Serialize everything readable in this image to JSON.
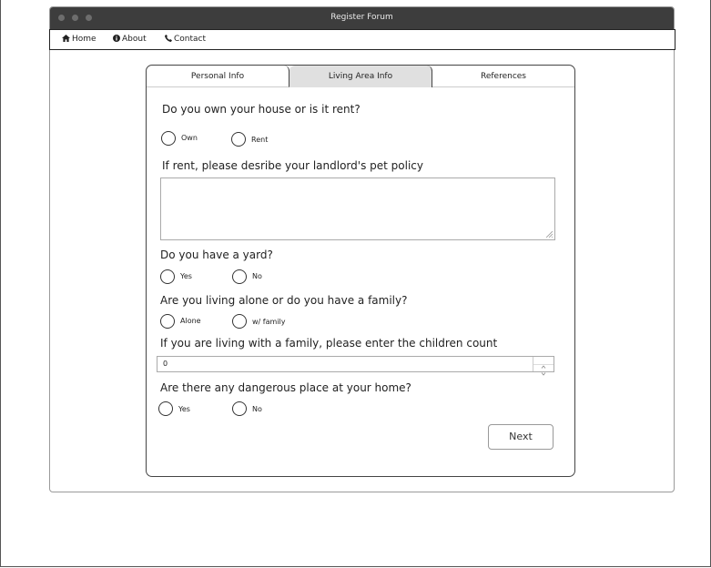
{
  "window": {
    "title": "Register Forum"
  },
  "nav": {
    "items": [
      {
        "label": "Home",
        "icon": "home-icon"
      },
      {
        "label": "About",
        "icon": "info-icon"
      },
      {
        "label": "Contact",
        "icon": "phone-icon"
      }
    ]
  },
  "tabs": [
    {
      "label": "Personal Info",
      "active": false
    },
    {
      "label": "Living Area Info",
      "active": true
    },
    {
      "label": "References",
      "active": false
    }
  ],
  "form": {
    "q_own": "Do you own your house or is it rent?",
    "own_options": [
      "Own",
      "Rent"
    ],
    "q_pet_policy": "If rent, please desribe your landlord's pet policy",
    "pet_policy_value": "",
    "q_yard": "Do you have a yard?",
    "yard_options": [
      "Yes",
      "No"
    ],
    "q_family": "Are you living alone or do you have a family?",
    "family_options": [
      "Alone",
      "w/ family"
    ],
    "q_children": "If you are living with a family, please enter the children count",
    "children_value": "0",
    "q_danger": "Are there any dangerous place at your home?",
    "danger_options": [
      "Yes",
      "No"
    ],
    "next_label": "Next"
  },
  "colors": {
    "titlebar": "#3d3d3d",
    "active_tab": "#e0e0e0",
    "border": "#444444"
  }
}
